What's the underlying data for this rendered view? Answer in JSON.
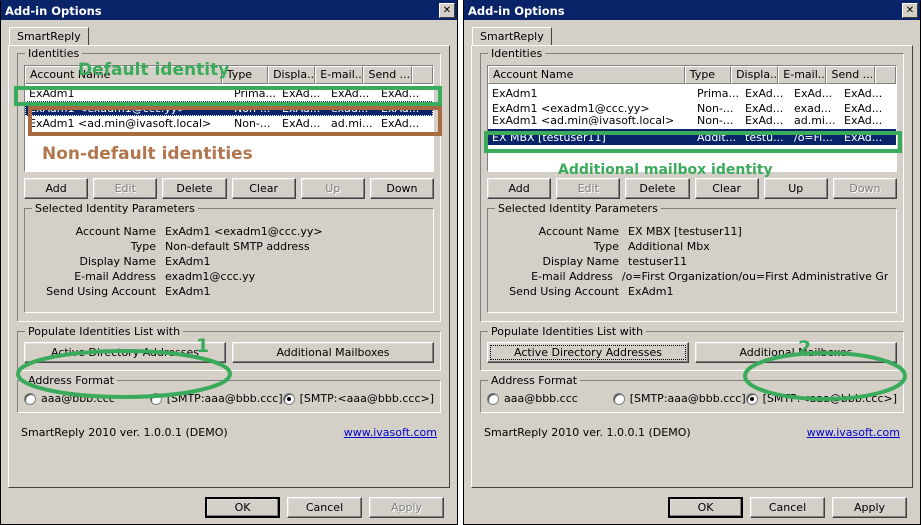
{
  "window": {
    "title": "Add-in Options",
    "close_icon": "close-icon",
    "close_glyph": "✕",
    "tab_label": "SmartReply",
    "colors": {
      "titlebar": "#0a246a",
      "face": "#d4d0c8",
      "selection": "#0a246a",
      "annotation_green": "#3aab5a",
      "annotation_brown": "#b0774f",
      "link": "#0000cc"
    }
  },
  "identities_group_label": "Identities",
  "columns": [
    {
      "label": "Account Name"
    },
    {
      "label": "Type"
    },
    {
      "label": "Displa..."
    },
    {
      "label": "E-mail..."
    },
    {
      "label": "Send ..."
    },
    {
      "label": ""
    }
  ],
  "left": {
    "rows": [
      {
        "account": "ExAdm1",
        "type": "Prima...",
        "display": "ExAd...",
        "email": "ExAd...",
        "send": "ExAd...",
        "state": "normal"
      },
      {
        "account": "ExAdm1  <exadm1@ccc.yy>",
        "type": "Non-...",
        "display": "ExAd...",
        "email": "exad...",
        "send": "ExAd...",
        "state": "selected"
      },
      {
        "account": "ExAdm1  <ad.min@ivasoft.local>",
        "type": "Non-...",
        "display": "ExAd...",
        "email": "ad.mi...",
        "send": "ExAd...",
        "state": "normal"
      }
    ],
    "buttons": [
      {
        "label": "Add",
        "disabled": false
      },
      {
        "label": "Edit",
        "disabled": true
      },
      {
        "label": "Delete",
        "disabled": false
      },
      {
        "label": "Clear",
        "disabled": false
      },
      {
        "label": "Up",
        "disabled": true
      },
      {
        "label": "Down",
        "disabled": false
      }
    ],
    "params_group_label": "Selected Identity Parameters",
    "params": [
      {
        "label": "Account Name",
        "value": "ExAdm1 <exadm1@ccc.yy>"
      },
      {
        "label": "Type",
        "value": "Non-default SMTP address"
      },
      {
        "label": "Display Name",
        "value": "ExAdm1"
      },
      {
        "label": "E-mail Address",
        "value": "exadm1@ccc.yy"
      },
      {
        "label": "Send Using Account",
        "value": "ExAdm1"
      }
    ],
    "populate_group_label": "Populate Identities List with",
    "populate_buttons": [
      {
        "label": "Active Directory Addresses",
        "focused": false
      },
      {
        "label": "Additional Mailboxes",
        "focused": false
      }
    ],
    "address_format_group_label": "Address Format",
    "address_formats": [
      {
        "label": "aaa@bbb.ccc",
        "checked": false
      },
      {
        "label": "[SMTP:aaa@bbb.ccc]",
        "checked": false
      },
      {
        "label": "[SMTP:<aaa@bbb.ccc>]",
        "checked": true
      }
    ],
    "version_text": "SmartReply 2010 ver. 1.0.0.1 (DEMO)",
    "link_text": "www.ivasoft.com",
    "dialog_buttons": [
      {
        "label": "OK",
        "disabled": false,
        "default": true
      },
      {
        "label": "Cancel",
        "disabled": false,
        "default": false
      },
      {
        "label": "Apply",
        "disabled": true,
        "default": false
      }
    ]
  },
  "right": {
    "rows": [
      {
        "account": "ExAdm1",
        "type": "Prima...",
        "display": "ExAd...",
        "email": "ExAd...",
        "send": "ExAd...",
        "state": "normal"
      },
      {
        "account": "ExAdm1  <exadm1@ccc.yy>",
        "type": "Non-...",
        "display": "ExAd...",
        "email": "exad...",
        "send": "ExAd...",
        "state": "normal"
      },
      {
        "account": "ExAdm1  <ad.min@ivasoft.local>",
        "type": "Non-...",
        "display": "ExAd...",
        "email": "ad.mi...",
        "send": "ExAd...",
        "state": "clipped"
      },
      {
        "account": "EX MBX [testuser11]",
        "type": "Addit...",
        "display": "testu...",
        "email": "/o=Fi...",
        "send": "ExAd...",
        "state": "selected"
      }
    ],
    "buttons": [
      {
        "label": "Add",
        "disabled": false
      },
      {
        "label": "Edit",
        "disabled": true
      },
      {
        "label": "Delete",
        "disabled": false
      },
      {
        "label": "Clear",
        "disabled": false
      },
      {
        "label": "Up",
        "disabled": false
      },
      {
        "label": "Down",
        "disabled": true
      }
    ],
    "params_group_label": "Selected Identity Parameters",
    "params": [
      {
        "label": "Account Name",
        "value": "EX MBX [testuser11]"
      },
      {
        "label": "Type",
        "value": "Additional Mbx"
      },
      {
        "label": "Display Name",
        "value": "testuser11"
      },
      {
        "label": "E-mail Address",
        "value": "/o=First  Organization/ou=First  Administrative  Grou"
      },
      {
        "label": "Send Using Account",
        "value": "ExAdm1"
      }
    ],
    "populate_group_label": "Populate Identities List with",
    "populate_buttons": [
      {
        "label": "Active Directory Addresses",
        "focused": true
      },
      {
        "label": "Additional Mailboxes",
        "focused": false
      }
    ],
    "address_format_group_label": "Address Format",
    "address_formats": [
      {
        "label": "aaa@bbb.ccc",
        "checked": false
      },
      {
        "label": "[SMTP:aaa@bbb.ccc]",
        "checked": false
      },
      {
        "label": "[SMTP:<aaa@bbb.ccc>]",
        "checked": true
      }
    ],
    "version_text": "SmartReply 2010 ver. 1.0.0.1 (DEMO)",
    "link_text": "www.ivasoft.com",
    "dialog_buttons": [
      {
        "label": "OK",
        "disabled": false,
        "default": true
      },
      {
        "label": "Cancel",
        "disabled": false,
        "default": false
      },
      {
        "label": "Apply",
        "disabled": false,
        "default": false
      }
    ]
  },
  "annotations": {
    "default_identity": "Default identity",
    "non_default_identities": "Non-default identities",
    "additional_mailbox_identity": "Additional mailbox identity",
    "step_one": "1",
    "step_two": "2"
  }
}
